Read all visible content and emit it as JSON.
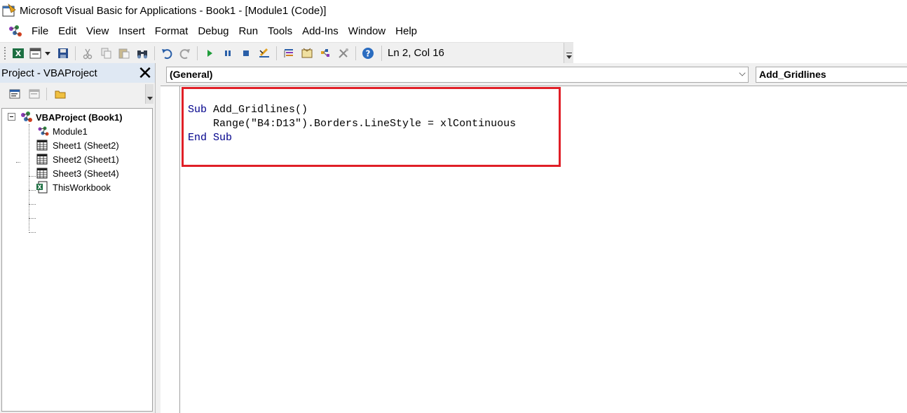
{
  "window": {
    "title": "Microsoft Visual Basic for Applications - Book1 - [Module1 (Code)]",
    "app_icon": "vba-editor-icon"
  },
  "menu": {
    "items": [
      "File",
      "Edit",
      "View",
      "Insert",
      "Format",
      "Debug",
      "Run",
      "Tools",
      "Add-Ins",
      "Window",
      "Help"
    ]
  },
  "toolbar": {
    "buttons": [
      "view-excel-icon",
      "insert-userform-icon",
      "save-icon",
      "cut-icon",
      "copy-icon",
      "paste-icon",
      "find-icon",
      "undo-icon",
      "redo-icon",
      "run-icon",
      "break-icon",
      "reset-icon",
      "design-mode-icon",
      "project-explorer-icon",
      "properties-window-icon",
      "object-browser-icon",
      "toolbox-icon",
      "help-icon"
    ],
    "cursor_position": "Ln 2, Col 16"
  },
  "project_pane": {
    "title": "Project - VBAProject",
    "close_glyph": "✕",
    "tree": {
      "root": "VBAProject (Book1)",
      "children": [
        "Module1",
        "Sheet1 (Sheet2)",
        "Sheet2 (Sheet1)",
        "Sheet3 (Sheet4)",
        "ThisWorkbook"
      ]
    }
  },
  "code_window": {
    "object_combo": "(General)",
    "procedure_combo": "Add_Gridlines",
    "lines": [
      {
        "kw1": "Sub",
        "rest": " Add_Gridlines()"
      },
      {
        "kw1": "",
        "rest": "    Range(\"B4:D13\").Borders.LineStyle = xlContinuous"
      },
      {
        "kw1": "End",
        "kw2": "Sub",
        "rest": ""
      }
    ]
  },
  "colors": {
    "highlight_border": "#e01f27",
    "keyword": "#00008b",
    "pane_header": "#dfe8f3"
  }
}
